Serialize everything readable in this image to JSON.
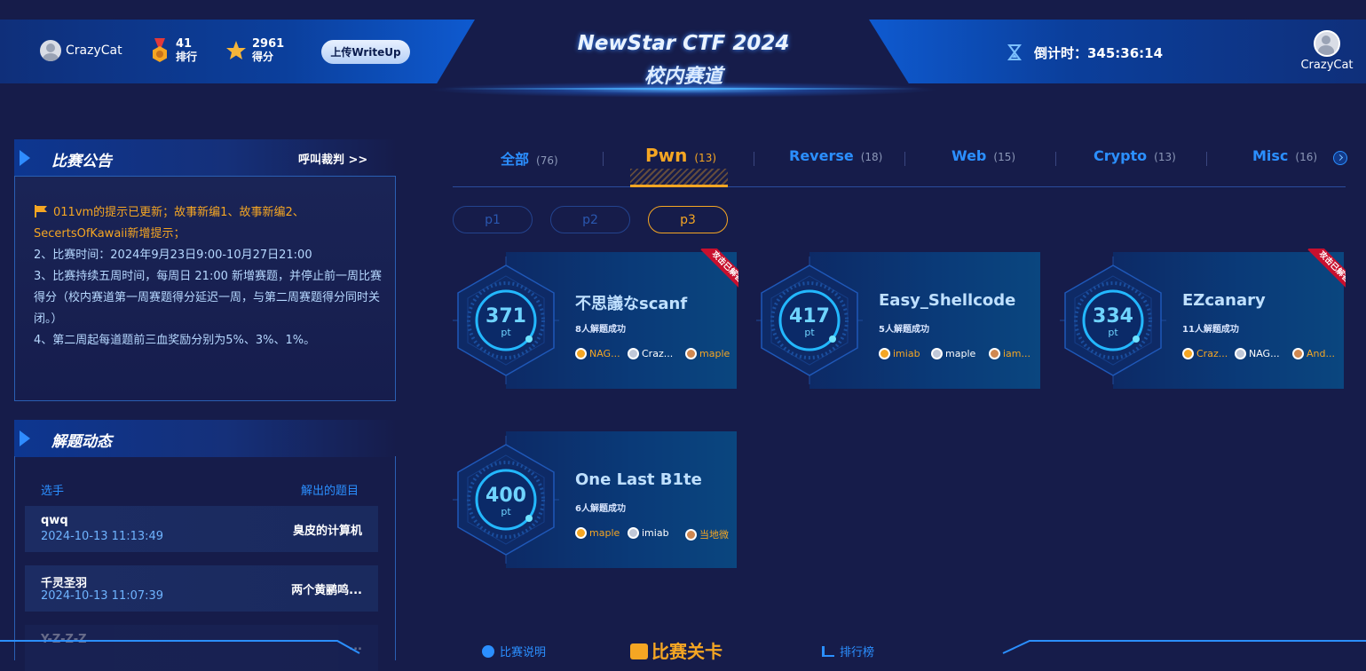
{
  "header": {
    "username": "CrazyCat",
    "rank_value": "41",
    "rank_label": "排行",
    "score_value": "2961",
    "score_label": "得分",
    "upload_label": "上传WriteUp",
    "title_line1": "NewStar CTF 2024",
    "title_line2": "校内赛道",
    "countdown_label": "倒计时：345:36:14",
    "profile_name": "CrazyCat"
  },
  "notice": {
    "title": "比赛公告",
    "call_judge": "呼叫裁判 >>",
    "line1": "011vm的提示已更新；故事新编1、故事新编2、SecertsOfKawaii新增提示；",
    "line2": "2、比赛时间：2024年9月23日9:00-10月27日21:00",
    "line3": "3、比赛持续五周时间，每周日 21:00 新增赛题，并停止前一周比赛得分（校内赛道第一周赛题得分延迟一周，与第二周赛题得分同时关闭。）",
    "line4": "4、第二周起每道题前三血奖励分别为5%、3%、1%。"
  },
  "feed": {
    "title": "解题动态",
    "col_player": "选手",
    "col_problem": "解出的题目",
    "rows": [
      {
        "name": "qwq",
        "time": "2024-10-13 11:13:49",
        "problem": "臭皮的计算机"
      },
      {
        "name": "千灵圣羽",
        "time": "2024-10-13 11:07:39",
        "problem": "两个黄鹂鸣..."
      },
      {
        "name": "Y-Z-Z-Z",
        "time": "",
        "problem": "..."
      }
    ]
  },
  "tabs": [
    {
      "label": "全部",
      "count": "(76)"
    },
    {
      "label": "Pwn",
      "count": "(13)"
    },
    {
      "label": "Reverse",
      "count": "(18)"
    },
    {
      "label": "Web",
      "count": "(15)"
    },
    {
      "label": "Crypto",
      "count": "(13)"
    },
    {
      "label": "Misc",
      "count": "(16)"
    }
  ],
  "pages": [
    "p1",
    "p2",
    "p3"
  ],
  "challenges": [
    {
      "name": "不思議なscanf",
      "points": "371",
      "unit": "pt",
      "solved": "8人解题成功",
      "ribbon": "攻击已解答",
      "solvers": [
        {
          "name": "NAG...",
          "color": "#f5a623"
        },
        {
          "name": "Craz...",
          "color": "#ffffff"
        },
        {
          "name": "maple",
          "color": "#f5a623"
        }
      ]
    },
    {
      "name": "Easy_Shellcode",
      "points": "417",
      "unit": "pt",
      "solved": "5人解题成功",
      "ribbon": "",
      "solvers": [
        {
          "name": "imiab",
          "color": "#f5a623"
        },
        {
          "name": "maple",
          "color": "#ffffff"
        },
        {
          "name": "iam...",
          "color": "#f5a623"
        }
      ]
    },
    {
      "name": "EZcanary",
      "points": "334",
      "unit": "pt",
      "solved": "11人解题成功",
      "ribbon": "攻击已解答",
      "solvers": [
        {
          "name": "Craz...",
          "color": "#f5a623"
        },
        {
          "name": "NAG...",
          "color": "#ffffff"
        },
        {
          "name": "And...",
          "color": "#f5a623"
        }
      ]
    },
    {
      "name": "One Last B1te",
      "points": "400",
      "unit": "pt",
      "solved": "6人解题成功",
      "ribbon": "",
      "solvers": [
        {
          "name": "maple",
          "color": "#f5a623"
        },
        {
          "name": "imiab",
          "color": "#ffffff"
        },
        {
          "name": "当地微",
          "color": "#f5a623"
        }
      ]
    }
  ],
  "bottom_nav": {
    "rules": "比赛说明",
    "center": "比赛关卡",
    "leaderboard": "排行榜"
  },
  "colors": {
    "accent_blue": "#2b8fff",
    "accent_orange": "#f5a623",
    "background": "#161c4a"
  }
}
